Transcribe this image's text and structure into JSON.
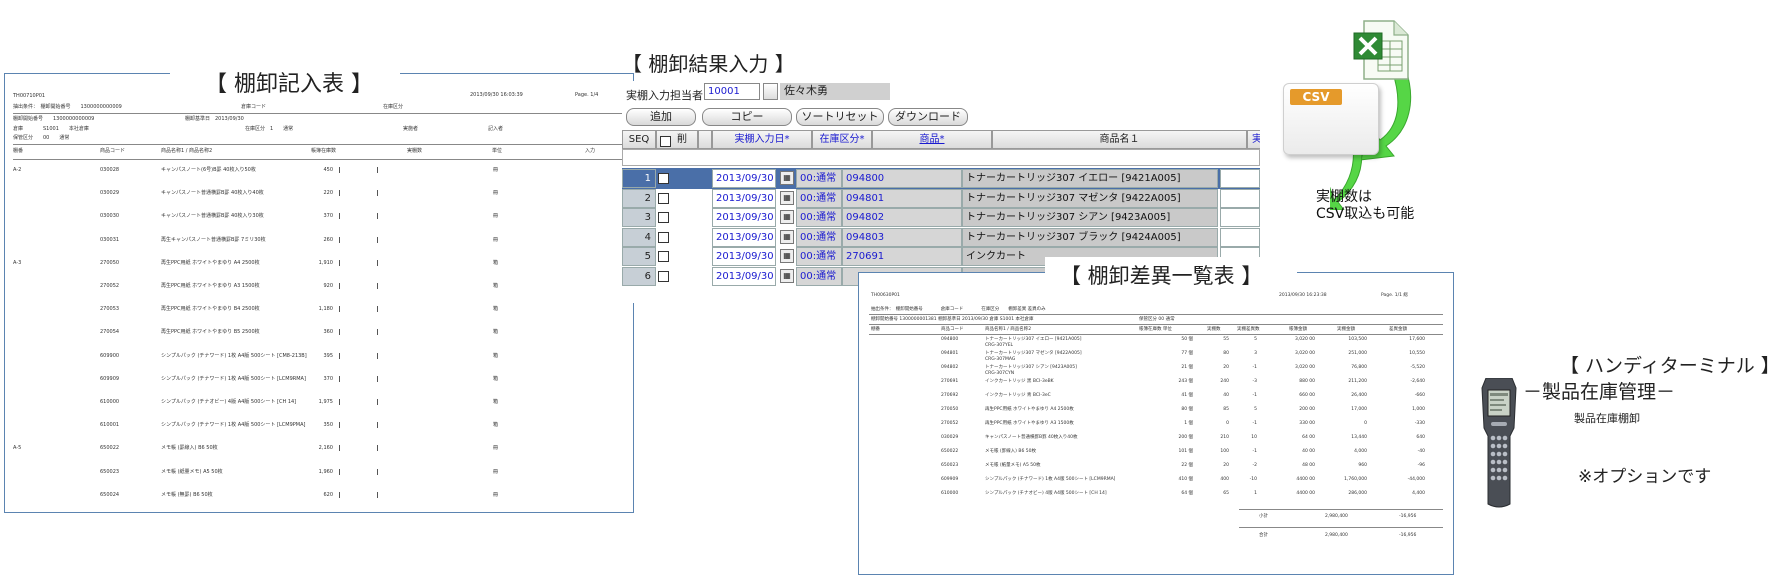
{
  "doc1": {
    "title": "【 棚卸記入表 】",
    "header": {
      "code": "TH00710P01",
      "datetime": "2013/09/30 16:03:39",
      "page": "Page. 1/4",
      "cond_label": "抽出条件：　棚卸開始番号　　1300000000009",
      "cond_mid": "倉庫コード",
      "cond_right": "在庫区分",
      "no_label": "棚卸開始番号　　1300000000009",
      "date_label": "棚卸基準日　2013/09/30",
      "warehouse_label": "倉庫　　　　S1001　　本社倉庫",
      "zone_label": "在庫区分　1　　通常",
      "loc_label": "保管区分　　00　　通常",
      "person_label": "実施者",
      "enter_label": "記入者"
    },
    "columns": [
      "棚番",
      "商品コード",
      "商品名称1 / 商品名称2",
      "帳簿在庫数",
      "実棚数",
      "単位",
      "入力"
    ],
    "rows": [
      {
        "shelf": "A-2",
        "code": "030028",
        "name": "キャンパスノート(6号)B罫 40枚入り50枚",
        "qty": "450",
        "unit": "冊"
      },
      {
        "shelf": "",
        "code": "030029",
        "name": "キャンパスノート普通横罫B罫 40枚入り40枚",
        "qty": "220",
        "unit": "冊"
      },
      {
        "shelf": "",
        "code": "030030",
        "name": "キャンパスノート普通横罫B罫 40枚入り30枚",
        "qty": "370",
        "unit": "冊"
      },
      {
        "shelf": "",
        "code": "030031",
        "name": "再生キャンパスノート普通横罫B罫 7ミリ30枚",
        "qty": "260",
        "unit": "冊"
      },
      {
        "shelf": "A-3",
        "code": "270050",
        "name": "再生PPC用紙 ホワイトやまゆり A4 2500枚",
        "qty": "1,910",
        "unit": "箱"
      },
      {
        "shelf": "",
        "code": "270052",
        "name": "再生PPC用紙 ホワイトやまゆり A3 1500枚",
        "qty": "920",
        "unit": "箱"
      },
      {
        "shelf": "",
        "code": "270053",
        "name": "再生PPC用紙 ホワイトやまゆり B4 2500枚",
        "qty": "1,180",
        "unit": "箱"
      },
      {
        "shelf": "",
        "code": "270054",
        "name": "再生PPC用紙 ホワイトやまゆり B5 2500枚",
        "qty": "360",
        "unit": "箱"
      },
      {
        "shelf": "",
        "code": "609900",
        "name": "シンプルパック (チナワード) 1枚 A4版 500シート [CM8-213B]",
        "qty": "395",
        "unit": "箱"
      },
      {
        "shelf": "",
        "code": "609909",
        "name": "シンプルパック (チナワード) 1枚 A4版 500シート [LCM9RMA]",
        "qty": "370",
        "unit": "箱"
      },
      {
        "shelf": "",
        "code": "610000",
        "name": "シンプルパック (チナオビー) 4版 A4版 500シート [CH 14]",
        "qty": "1,975",
        "unit": "箱"
      },
      {
        "shelf": "",
        "code": "610001",
        "name": "シンプルパック (チナワード) 1枚 A4版 500シート [LCM9PMA]",
        "qty": "350",
        "unit": "箱"
      },
      {
        "shelf": "A-5",
        "code": "650022",
        "name": "メモ帳 (罫線入) B6 50枚",
        "qty": "2,160",
        "unit": "冊"
      },
      {
        "shelf": "",
        "code": "650023",
        "name": "メモ帳 (紙量メモ) A5 50枚",
        "qty": "1,960",
        "unit": "冊"
      },
      {
        "shelf": "",
        "code": "650024",
        "name": "メモ帳 (無罫) B6 50枚",
        "qty": "620",
        "unit": "冊"
      }
    ]
  },
  "form": {
    "title": "【 棚卸結果入力 】",
    "person_label": "実棚入力担当者",
    "person_code": "10001",
    "person_name": "佐々木勇",
    "buttons": [
      "追加",
      "コピー",
      "ソートリセット",
      "ダウンロード"
    ],
    "columns": {
      "seq": "SEQ",
      "del": "削",
      "date": "実棚入力日*",
      "zone": "在庫区分*",
      "code": "商品*",
      "name": "商品名１",
      "cut": "実"
    },
    "rows": [
      {
        "seq": "1",
        "date": "2013/09/30",
        "zone": "00:通常",
        "code": "094800",
        "name": "トナーカートリッジ307 イエロー  [9421A005]"
      },
      {
        "seq": "2",
        "date": "2013/09/30",
        "zone": "00:通常",
        "code": "094801",
        "name": "トナーカートリッジ307 マゼンタ  [9422A005]"
      },
      {
        "seq": "3",
        "date": "2013/09/30",
        "zone": "00:通常",
        "code": "094802",
        "name": "トナーカートリッジ307 シアン  [9423A005]"
      },
      {
        "seq": "4",
        "date": "2013/09/30",
        "zone": "00:通常",
        "code": "094803",
        "name": "トナーカートリッジ307 ブラック  [9424A005]"
      },
      {
        "seq": "5",
        "date": "2013/09/30",
        "zone": "00:通常",
        "code": "270691",
        "name": "インクカート"
      },
      {
        "seq": "6",
        "date": "2013/09/30",
        "zone": "00:通常",
        "code": "",
        "name": ""
      }
    ]
  },
  "csv": {
    "badge": "CSV",
    "note_line1": "実棚数は",
    "note_line2": "CSV取込も可能"
  },
  "doc2": {
    "title": "【 棚卸差異一覧表 】",
    "code": "TH00630P01",
    "datetime": "2013/09/30 16:23:38",
    "page": "Page. 1/1 総",
    "cond": "抽出条件：　棚卸開始番号　　　　倉庫コード　　　　在庫区分　　棚卸差異 差異のみ",
    "no_line": "棚卸開始番号 1300000001381  棚卸基準日 2013/09/30  倉庫 S1001  本社倉庫",
    "zone_line": "保管区分 00  通常",
    "columns": [
      "棚番",
      "商品コード",
      "商品名称1 / 商品名称2",
      "帳簿在庫数 単位",
      "実棚数",
      "実棚差異数",
      "帳簿金額",
      "実棚金額",
      "差異金額"
    ],
    "rows": [
      {
        "code": "094800",
        "name": "トナーカートリッジ307 イエロー [9421A005]",
        "sub": "CRG-307YEL",
        "book": "50 個",
        "act": "55",
        "diff": "5",
        "p1": "3,020 00",
        "p2": "103,500",
        "p3": "17,600"
      },
      {
        "code": "094801",
        "name": "トナーカートリッジ307 マゼンタ [9422A005]",
        "sub": "CRG-307MAG",
        "book": "77 個",
        "act": "80",
        "diff": "3",
        "p1": "3,020 00",
        "p2": "251,000",
        "p3": "10,550"
      },
      {
        "code": "094802",
        "name": "トナーカートリッジ307 シアン [9423A005]",
        "sub": "CRG-307CYN",
        "book": "21 個",
        "act": "20",
        "diff": "-1",
        "p1": "3,020 00",
        "p2": "76,800",
        "p3": "-5,520"
      },
      {
        "code": "270691",
        "name": "インクカートリッジ 黒 BCI-3eBK",
        "sub": "",
        "book": "243 個",
        "act": "240",
        "diff": "-3",
        "p1": "880 00",
        "p2": "211,200",
        "p3": "-2,640"
      },
      {
        "code": "270692",
        "name": "インクカートリッジ 青 BCI-3eC",
        "sub": "",
        "book": "41 個",
        "act": "40",
        "diff": "-1",
        "p1": "660 00",
        "p2": "26,400",
        "p3": "-660"
      },
      {
        "code": "270050",
        "name": "再生PPC用紙 ホワイトやまゆり A4 2500枚",
        "sub": "",
        "book": "80 個",
        "act": "85",
        "diff": "5",
        "p1": "200 00",
        "p2": "17,000",
        "p3": "1,000"
      },
      {
        "code": "270052",
        "name": "再生PPC用紙 ホワイトやまゆり A3 1500枚",
        "sub": "",
        "book": "1 個",
        "act": "0",
        "diff": "-1",
        "p1": "330 00",
        "p2": "0",
        "p3": "-330"
      },
      {
        "code": "030029",
        "name": "キャンパスノート普通横罫B罫 40枚入り40枚",
        "sub": "",
        "book": "200 個",
        "act": "210",
        "diff": "10",
        "p1": "64 00",
        "p2": "13,440",
        "p3": "640"
      },
      {
        "code": "650022",
        "name": "メモ帳 (罫線入) B6 50枚",
        "sub": "",
        "book": "101 個",
        "act": "100",
        "diff": "-1",
        "p1": "40 00",
        "p2": "4,000",
        "p3": "-40"
      },
      {
        "code": "650023",
        "name": "メモ帳 (紙量メモ) A5 50枚",
        "sub": "",
        "book": "22 個",
        "act": "20",
        "diff": "-2",
        "p1": "48 00",
        "p2": "960",
        "p3": "-96"
      },
      {
        "code": "609909",
        "name": "シンプルパック (チナワード) 1枚 A4版 500シート [LCM9RMA]",
        "sub": "",
        "book": "410 個",
        "act": "400",
        "diff": "-10",
        "p1": "4400 00",
        "p2": "1,760,000",
        "p3": "-44,000"
      },
      {
        "code": "610000",
        "name": "シンプルパック (チナオビー) 4版 A4版 500シート [CH 14]",
        "sub": "",
        "book": "64 個",
        "act": "65",
        "diff": "1",
        "p1": "4400 00",
        "p2": "286,000",
        "p3": "4,400"
      }
    ],
    "subtotal_label": "小計",
    "subtotal_amount": "2,980,400",
    "subtotal_diff": "-16,956",
    "total_label": "合計",
    "total_amount": "2,980,400",
    "total_diff": "-16,956"
  },
  "handy": {
    "title": "【 ハンディターミナル 】",
    "subtitle": "－製品在庫管理－",
    "subtitle2": "製品在庫棚卸",
    "option": "※オプションです"
  },
  "colors": {
    "doc_border": "#5b84b1",
    "link_blue": "#1a1ad0",
    "csv_orange": "#e59a2b",
    "arrow_green": "#4cd13b"
  }
}
